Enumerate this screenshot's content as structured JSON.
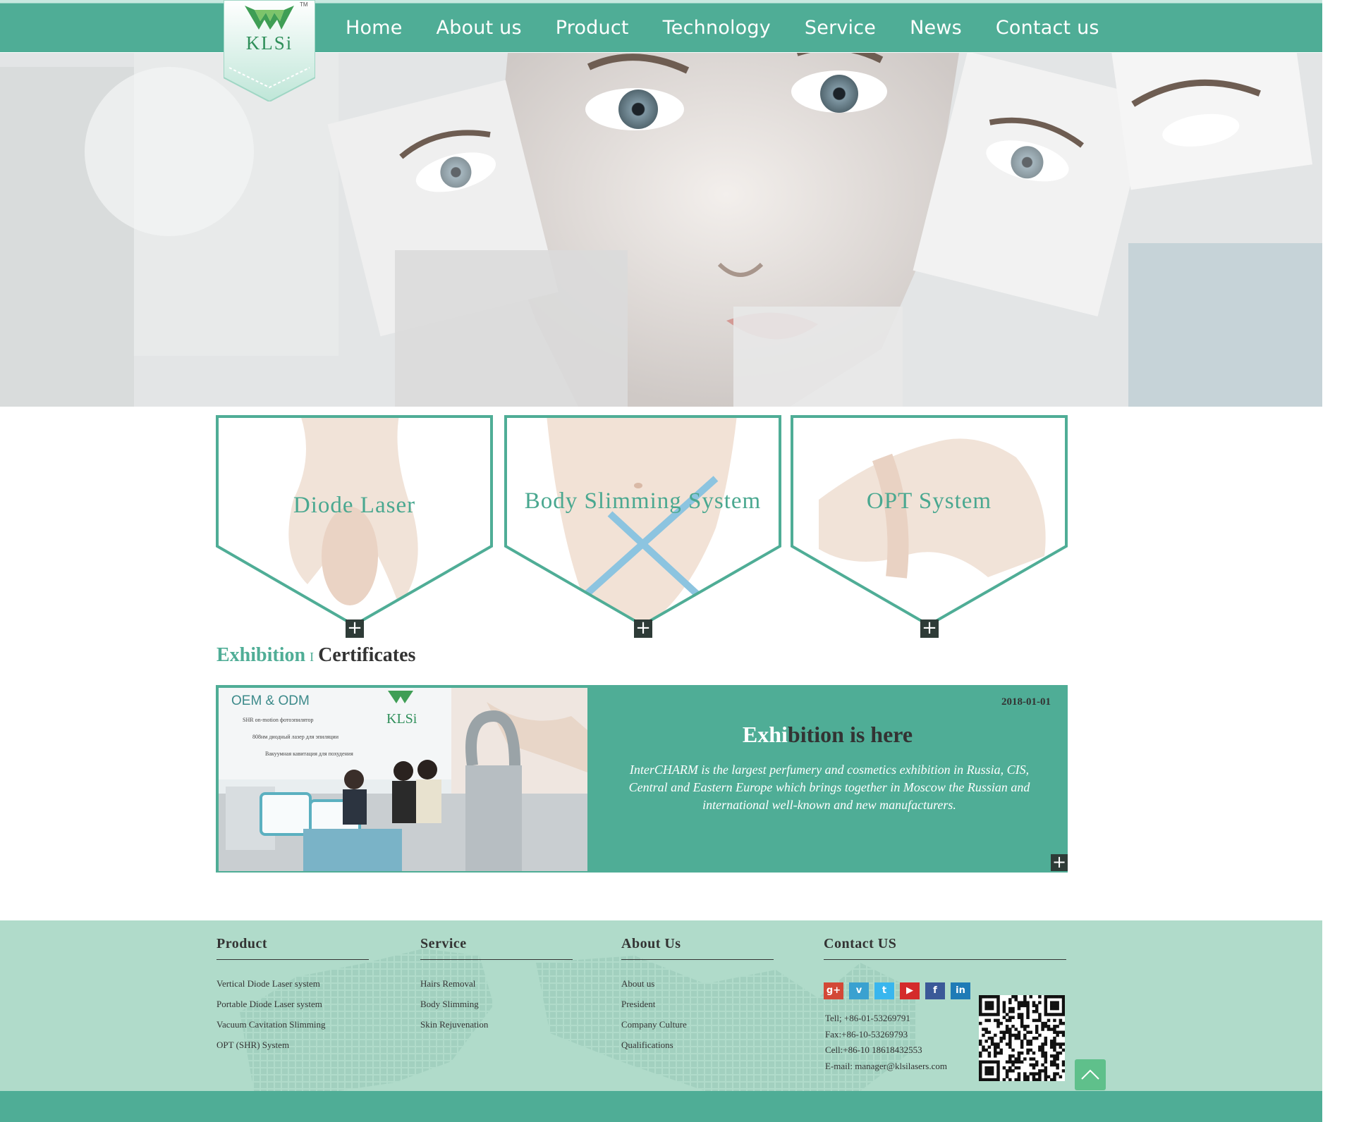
{
  "brand": {
    "logo_text": "KLSi",
    "trademark": "TM"
  },
  "nav": {
    "items": [
      "Home",
      "About us",
      "Product",
      "Technology",
      "Service",
      "News",
      "Contact us"
    ]
  },
  "colors": {
    "accent": "#4fad96",
    "footer_bg": "#b0dbca",
    "title_teal": "#4aa890"
  },
  "cards": [
    {
      "title": "Diode Laser"
    },
    {
      "title": "Body Slimming System"
    },
    {
      "title": "OPT System"
    }
  ],
  "section": {
    "tab_exhibition": "Exhibition",
    "separator": "I",
    "tab_certificates": "Certificates"
  },
  "exhibition": {
    "date": "2018-01-01",
    "headline_highlight": "Exhi",
    "headline_rest": "bition is here",
    "body": "InterCHARM is the largest perfumery and cosmetics exhibition in Russia, CIS, Central and Eastern Europe which brings together in Moscow the Russian and international well-known and new manufacturers.",
    "photo_caption": "OEM & ODM",
    "photo_logo": "KLSi",
    "photo_lines": [
      "SHR on-motion фотоэпилятор",
      "808нм диодный лазер для эпиляции",
      "Вакуумная кавитация для похудения"
    ]
  },
  "footer": {
    "product": {
      "heading": "Product",
      "items": [
        "Vertical Diode Laser system",
        "Portable Diode Laser system",
        "Vacuum Cavitation Slimming",
        "OPT (SHR) System"
      ]
    },
    "service": {
      "heading": "Service",
      "items": [
        "Hairs Removal",
        "Body Slimming",
        "Skin Rejuvenation"
      ]
    },
    "about": {
      "heading": "About Us",
      "items": [
        "About us",
        "President",
        "Company Culture",
        "Qualifications"
      ]
    },
    "contact": {
      "heading": "Contact US",
      "social": [
        {
          "icon": "google-plus-icon",
          "glyph": "g+",
          "color": "#d34836"
        },
        {
          "icon": "vimeo-icon",
          "glyph": "v",
          "color": "#3aa1d0"
        },
        {
          "icon": "twitter-icon",
          "glyph": "t",
          "color": "#38b6ee"
        },
        {
          "icon": "youtube-icon",
          "glyph": "▶",
          "color": "#d42b2b"
        },
        {
          "icon": "facebook-icon",
          "glyph": "f",
          "color": "#3b5998"
        },
        {
          "icon": "linkedin-icon",
          "glyph": "in",
          "color": "#1f7bb6"
        }
      ],
      "tel": "Tell; +86-01-53269791",
      "fax": "Fax:+86-10-53269793",
      "cell": "Cell:+86-10 18618432553",
      "email": "E-mail: manager@klsilasers.com"
    }
  }
}
